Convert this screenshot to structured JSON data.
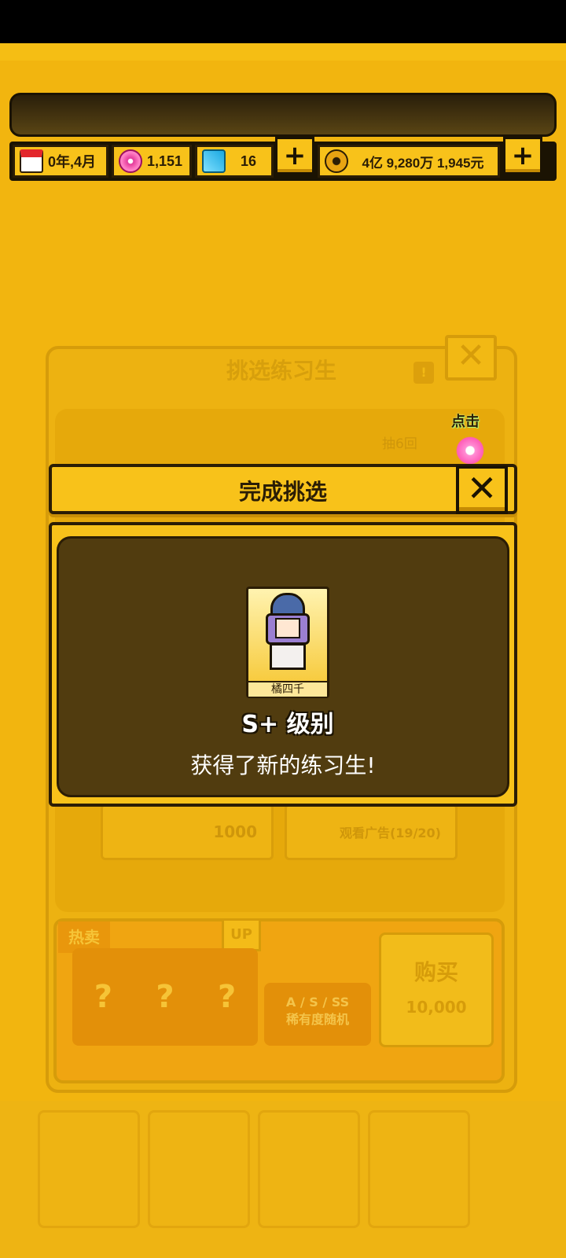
{
  "colors": {
    "background": "#F2B50F",
    "accent": "#F8C21A",
    "panel_dark": "#513C0F",
    "outline": "#2b1d05"
  },
  "resources": {
    "date": "0年,4月",
    "gems": "1,151",
    "diamonds": "16",
    "money": "4亿 9,280万 1,945元",
    "icons": [
      "calendar-icon",
      "pink-gem-icon",
      "diamond-icon",
      "coin-icon"
    ]
  },
  "background_panel": {
    "title": "挑选练习生",
    "draw_six": "抽6回",
    "cost_button": "1000",
    "ad_button": "观看广告(19/20)",
    "shop": {
      "hot_tag": "热卖",
      "up_tag": "UP",
      "mystery": [
        "?",
        "?",
        "?"
      ],
      "random_line1": "A / S / SS",
      "random_line2": "稀有度随机",
      "buy_label": "购买",
      "buy_price": "10,000"
    }
  },
  "hint": {
    "tap": "点击"
  },
  "modal": {
    "title": "完成挑选",
    "close": "✕",
    "trainee_name": "橘四千",
    "grade": "S+ 级别",
    "message": "获得了新的练习生!"
  }
}
